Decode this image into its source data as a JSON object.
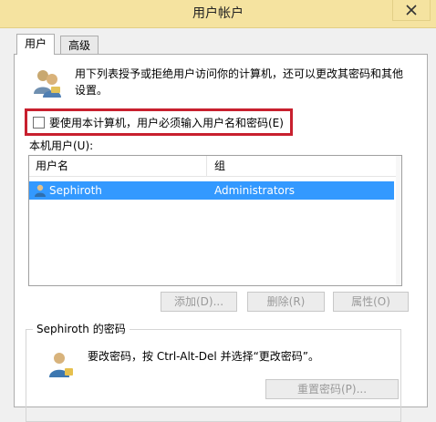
{
  "window": {
    "title": "用户帐户"
  },
  "tabs": [
    {
      "label": "用户",
      "active": true
    },
    {
      "label": "高级",
      "active": false
    }
  ],
  "panel": {
    "description": "用下列表授予或拒绝用户访问你的计算机，还可以更改其密码和其他设置。",
    "require_login_checkbox": {
      "label": "要使用本计算机，用户必须输入用户名和密码(E)",
      "checked": false
    },
    "local_users_label": "本机用户(U):",
    "columns": [
      "用户名",
      "组"
    ],
    "users": [
      {
        "name": "Sephiroth",
        "group": "Administrators",
        "selected": true
      }
    ],
    "buttons": {
      "add": "添加(D)...",
      "remove": "删除(R)",
      "properties": "属性(O)"
    },
    "password_group": {
      "title": "Sephiroth 的密码",
      "description": "要改密码，按 Ctrl-Alt-Del 并选择“更改密码”。",
      "reset_button": "重置密码(P)..."
    }
  },
  "colors": {
    "title_bar": "#f5e3a0",
    "selection": "#3399ff",
    "highlight_border": "#c8202e"
  },
  "icons": {
    "close": "close-icon",
    "users": "users-icon",
    "user_row": "user-icon",
    "password": "user-key-icon"
  }
}
